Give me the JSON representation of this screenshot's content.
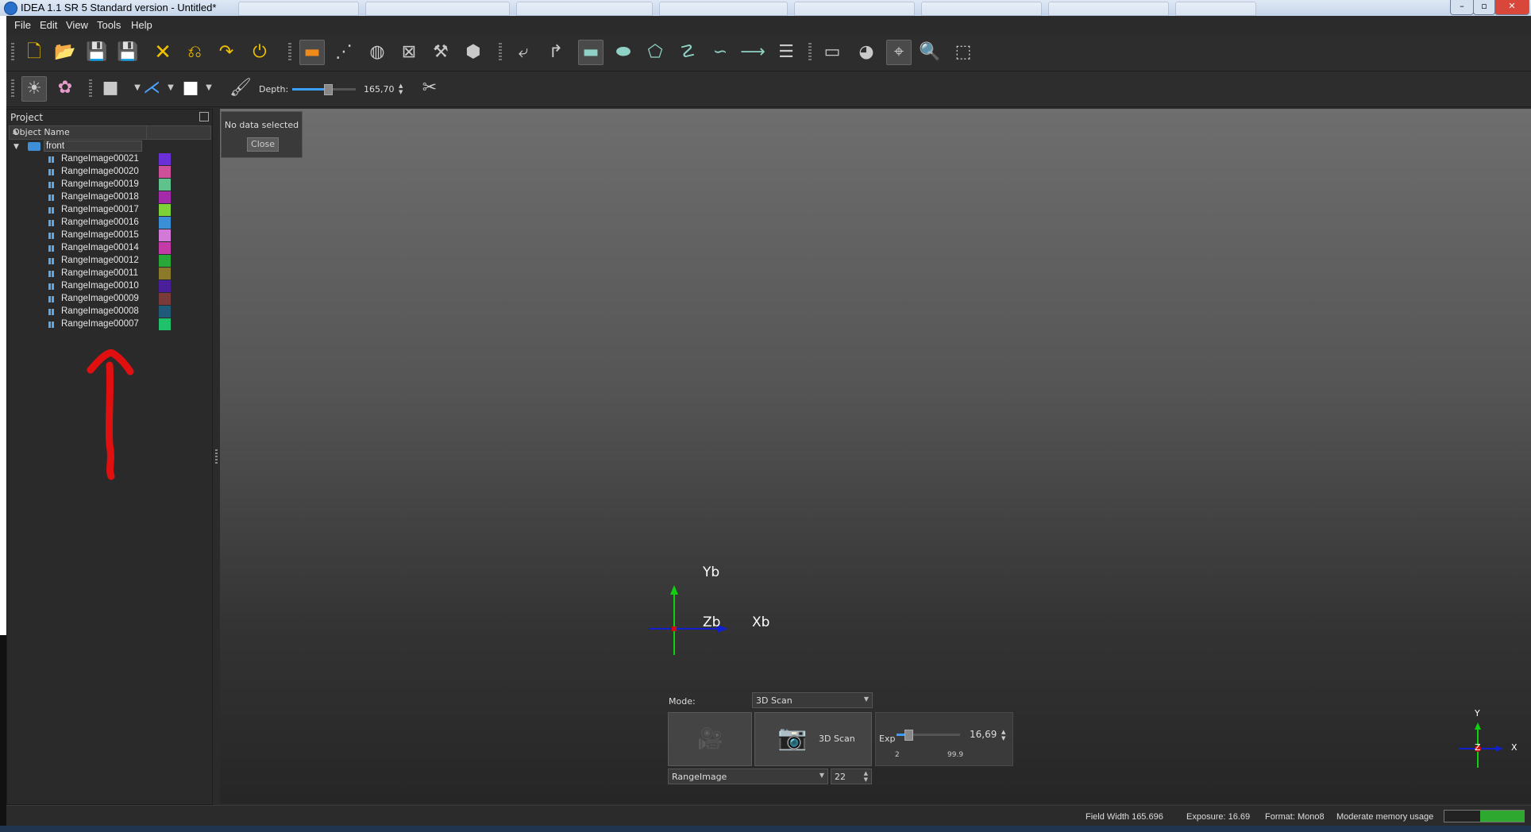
{
  "window": {
    "title": "IDEA 1.1 SR 5 Standard version - Untitled*",
    "minimize": "–",
    "maximize": "▫",
    "close": "✕"
  },
  "menu": [
    {
      "label": "File"
    },
    {
      "label": "Edit"
    },
    {
      "label": "View"
    },
    {
      "label": "Tools"
    },
    {
      "label": "Help"
    }
  ],
  "toolbar2": {
    "depth_label": "Depth:",
    "depth_value": "165,70",
    "depth_fraction": 0.55
  },
  "panel": {
    "title": "Project",
    "column_header": "Object Name",
    "group": "front",
    "items": [
      {
        "label": "RangeImage00021",
        "color": "#6a2fd6"
      },
      {
        "label": "RangeImage00020",
        "color": "#d04f9a"
      },
      {
        "label": "RangeImage00019",
        "color": "#5fc28c"
      },
      {
        "label": "RangeImage00018",
        "color": "#a32aa8"
      },
      {
        "label": "RangeImage00017",
        "color": "#7fd13a"
      },
      {
        "label": "RangeImage00016",
        "color": "#3c8fd6"
      },
      {
        "label": "RangeImage00015",
        "color": "#d27ad8"
      },
      {
        "label": "RangeImage00014",
        "color": "#c43aa6"
      },
      {
        "label": "RangeImage00012",
        "color": "#28a838"
      },
      {
        "label": "RangeImage00011",
        "color": "#8a7a2a"
      },
      {
        "label": "RangeImage00010",
        "color": "#4a1f9a"
      },
      {
        "label": "RangeImage00009",
        "color": "#7a3a3a"
      },
      {
        "label": "RangeImage00008",
        "color": "#1f5a7a"
      },
      {
        "label": "RangeImage00007",
        "color": "#1fc26a"
      }
    ]
  },
  "info_popup": {
    "text": "No data selected",
    "close_label": "Close"
  },
  "axes_main": {
    "y": "Yb",
    "z": "Zb",
    "x": "Xb"
  },
  "axes_mini": {
    "y": "Y",
    "z": "Z",
    "x": "X"
  },
  "scan": {
    "mode_label": "Mode:",
    "mode_value": "3D Scan",
    "scan_button": "3D Scan",
    "exp_label": "Exp",
    "exp_value": "16,69",
    "exp_min": "2",
    "exp_max": "99.9",
    "exp_fraction": 0.17,
    "output_type": "RangeImage",
    "output_index": "22"
  },
  "status": {
    "field_width": "Field Width 165.696",
    "exposure": "Exposure: 16.69",
    "format": "Format: Mono8",
    "memory": "Moderate memory usage",
    "memory_fraction": 0.55
  },
  "colors": {
    "arrow": "#e01010",
    "axis_x": "#1020d0",
    "axis_y": "#10d010",
    "axis_z": "#d01010"
  }
}
